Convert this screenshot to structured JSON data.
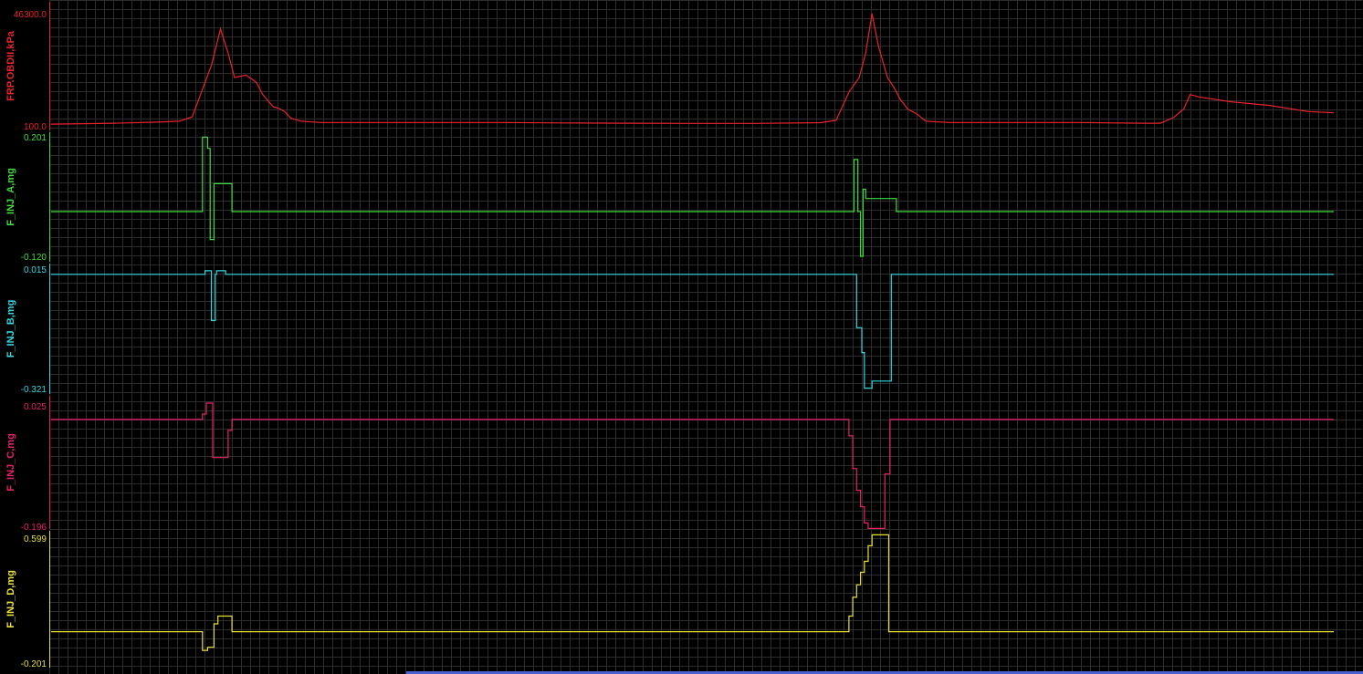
{
  "colors": {
    "background": "#000000",
    "grid": "#2c2c2c",
    "scroll_indicator": "#4a5fd0"
  },
  "chart_data": [
    {
      "type": "line",
      "ylabel": "FRP.OBDII,kPa",
      "color": "#e8232b",
      "ylim": [
        100.0,
        46300.0
      ],
      "ymax_label": "46300.0",
      "ymin_label": "100.0",
      "grid": true,
      "series": [
        {
          "x": [
            0,
            5,
            8,
            10,
            11,
            12,
            12.5,
            13.2,
            13.8,
            14.3,
            15.2,
            16,
            16.5,
            17.3,
            17.8,
            18.2,
            18.7,
            19.5,
            21,
            25,
            30,
            35,
            40,
            45,
            50,
            55,
            60,
            61.2,
            62.2,
            63,
            63.5,
            64,
            64.5,
            65.2,
            65.7,
            66.2,
            66.8,
            67.5,
            68.2,
            70,
            75,
            80,
            85,
            86.5,
            87.5,
            88.3,
            88.8,
            89.5,
            92,
            95,
            98,
            100
          ],
          "y": [
            800,
            1200,
            1600,
            2000,
            3800,
            18000,
            25000,
            40000,
            30000,
            20000,
            21000,
            18000,
            13000,
            8000,
            7200,
            6000,
            3200,
            2000,
            1500,
            1500,
            1500,
            1500,
            1300,
            1200,
            1100,
            1100,
            1400,
            2400,
            14000,
            20000,
            30000,
            46300,
            33000,
            20000,
            16000,
            11000,
            7000,
            5000,
            2000,
            1500,
            1500,
            1500,
            1200,
            1200,
            3500,
            7000,
            13000,
            12000,
            10000,
            8500,
            6000,
            5500
          ]
        }
      ]
    },
    {
      "type": "line",
      "ylabel": "F_INJ_A,mg",
      "color": "#3ddc3d",
      "ylim": [
        -0.12,
        0.201
      ],
      "ymax_label": "0.201",
      "ymin_label": "-0.120",
      "grid": true,
      "series": [
        {
          "x": [
            0,
            11.8,
            11.8,
            12.2,
            12.2,
            12.4,
            12.4,
            12.7,
            12.7,
            12.9,
            12.9,
            13.6,
            13.6,
            14.1,
            14.1,
            62.6,
            62.6,
            62.9,
            62.9,
            63.1,
            63.1,
            63.3,
            63.3,
            63.5,
            63.5,
            64.3,
            64.3,
            65.9,
            65.9,
            100
          ],
          "y": [
            0,
            0,
            0.2,
            0.2,
            0.17,
            0.17,
            -0.075,
            -0.075,
            0.075,
            0.075,
            0.075,
            0.075,
            0.075,
            0.075,
            0,
            0,
            0.14,
            0.14,
            0,
            0,
            -0.12,
            -0.12,
            0.06,
            0.06,
            0.035,
            0.035,
            0.035,
            0.035,
            0,
            0
          ]
        }
      ]
    },
    {
      "type": "line",
      "ylabel": "F_INJ_B,mg",
      "color": "#30d8e0",
      "ylim": [
        -0.321,
        0.015
      ],
      "ymax_label": "0.015",
      "ymin_label": "-0.321",
      "grid": true,
      "series": [
        {
          "x": [
            0,
            12,
            12,
            12.2,
            12.2,
            12.5,
            12.5,
            12.8,
            12.8,
            12.9,
            12.9,
            13.2,
            13.2,
            13.6,
            13.6,
            14.1,
            14.1,
            62.8,
            62.8,
            63.2,
            63.2,
            63.4,
            63.4,
            63.7,
            63.7,
            64,
            64,
            64.2,
            64.2,
            65.2,
            65.2,
            65.5,
            65.5,
            100
          ],
          "y": [
            0,
            0,
            0.01,
            0.01,
            0.01,
            0.01,
            -0.13,
            -0.13,
            0,
            0,
            0.01,
            0.01,
            0.01,
            0.01,
            0,
            0,
            0,
            0,
            -0.15,
            -0.15,
            -0.22,
            -0.22,
            -0.32,
            -0.32,
            -0.32,
            -0.32,
            -0.3,
            -0.3,
            -0.3,
            -0.3,
            -0.3,
            -0.3,
            0,
            0
          ]
        }
      ]
    },
    {
      "type": "line",
      "ylabel": "F_INJ_C,mg",
      "color": "#e8206a",
      "ylim": [
        -0.196,
        0.025
      ],
      "ymax_label": "0.025",
      "ymin_label": "-0.196",
      "grid": true,
      "series": [
        {
          "x": [
            0,
            11.8,
            11.8,
            12.1,
            12.1,
            12.6,
            12.6,
            12.9,
            12.9,
            13.8,
            13.8,
            14.1,
            14.1,
            62.2,
            62.2,
            62.5,
            62.5,
            62.8,
            62.8,
            63.1,
            63.1,
            63.4,
            63.4,
            63.7,
            63.7,
            64.3,
            64.3,
            65,
            65,
            65.4,
            65.4,
            100
          ],
          "y": [
            0,
            0,
            0.01,
            0.01,
            0.03,
            0.03,
            -0.07,
            -0.07,
            -0.07,
            -0.07,
            -0.02,
            -0.02,
            0,
            0,
            -0.03,
            -0.03,
            -0.09,
            -0.09,
            -0.13,
            -0.13,
            -0.16,
            -0.16,
            -0.19,
            -0.19,
            -0.2,
            -0.2,
            -0.2,
            -0.2,
            -0.1,
            -0.1,
            0,
            0
          ]
        }
      ]
    },
    {
      "type": "line",
      "ylabel": "F_INJ_D,mg",
      "color": "#e8e030",
      "ylim": [
        -0.201,
        0.599
      ],
      "ymax_label": "0.599",
      "ymin_label": "-0.201",
      "grid": true,
      "series": [
        {
          "x": [
            0,
            11.8,
            11.8,
            12.2,
            12.2,
            12.7,
            12.7,
            13,
            13,
            14.1,
            14.1,
            62.2,
            62.2,
            62.5,
            62.5,
            62.8,
            62.8,
            63.1,
            63.1,
            63.4,
            63.4,
            63.7,
            63.7,
            64,
            64,
            64.3,
            64.3,
            65.3,
            65.3,
            100
          ],
          "y": [
            0,
            0,
            -0.12,
            -0.12,
            -0.1,
            -0.1,
            0.05,
            0.05,
            0.1,
            0.1,
            0,
            0,
            0.1,
            0.1,
            0.22,
            0.22,
            0.3,
            0.3,
            0.38,
            0.38,
            0.45,
            0.45,
            0.55,
            0.55,
            0.62,
            0.62,
            0.62,
            0.62,
            0,
            0
          ]
        }
      ]
    }
  ]
}
